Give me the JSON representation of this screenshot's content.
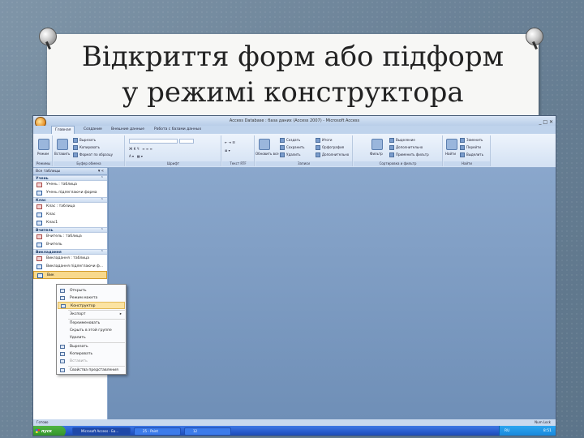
{
  "slide": {
    "title_line1": "Відкриття форм або підформ",
    "title_line2": "у режимі конструктора"
  },
  "app": {
    "window_title": "Access Database : база даних (Access 2007) - Microsoft Access",
    "window_controls": "_ □ ✕",
    "tabs": [
      "Главная",
      "Создание",
      "Внешние данные",
      "Работа с базами данных"
    ]
  },
  "ribbon": {
    "groups": [
      "Режимы",
      "Буфер обмена",
      "Шрифт",
      "Текст RTF",
      "Записи",
      "Сортировка и фильтр",
      "Найти"
    ],
    "items": {
      "view": "Режим",
      "paste": "Вставить",
      "cut": "Вырезать",
      "copy": "Копировать",
      "format_painter": "Формат по образцу",
      "refresh": "Обновить все",
      "new": "Создать",
      "save": "Сохранить",
      "delete": "Удалить",
      "totals": "Итоги",
      "spelling": "Орфография",
      "more": "Дополнительно",
      "sort_filter": "Фильтр",
      "selection": "Выделение",
      "advanced": "Дополнительно",
      "toggle_filter": "Применить фильтр",
      "find": "Найти",
      "replace": "Заменить",
      "goto": "Перейти",
      "select": "Выделить"
    }
  },
  "nav": {
    "header": "Все таблицы",
    "groups": [
      {
        "name": "Учень",
        "items": [
          {
            "label": "Учень : таблица",
            "type": "table"
          },
          {
            "label": "Учень підлеглаючи форма",
            "type": "form"
          }
        ]
      },
      {
        "name": "Клас",
        "items": [
          {
            "label": "Клас : таблица",
            "type": "table"
          },
          {
            "label": "Клас",
            "type": "form"
          },
          {
            "label": "Клас1",
            "type": "form"
          }
        ]
      },
      {
        "name": "Вчитель",
        "items": [
          {
            "label": "Вчитель : таблица",
            "type": "table"
          },
          {
            "label": "Вчитель",
            "type": "form"
          }
        ]
      },
      {
        "name": "Викладання",
        "items": [
          {
            "label": "Викладання : таблица",
            "type": "table"
          },
          {
            "label": "Викладання підлеглаючи ф...",
            "type": "form"
          },
          {
            "label": "Вик",
            "type": "form"
          }
        ]
      }
    ]
  },
  "context_menu": {
    "items": [
      {
        "label": "Открыть",
        "disabled": false
      },
      {
        "label": "Режим макета",
        "disabled": false
      },
      {
        "label": "Конструктор",
        "disabled": false
      },
      {
        "label": "Экспорт",
        "disabled": false
      },
      {
        "label": "Переименовать",
        "disabled": false
      },
      {
        "label": "Скрыть в этой группе",
        "disabled": false
      },
      {
        "label": "Удалить",
        "disabled": false
      },
      {
        "label": "Вырезать",
        "disabled": false
      },
      {
        "label": "Копировать",
        "disabled": false
      },
      {
        "label": "Вставить",
        "disabled": true
      },
      {
        "label": "Свойства представления",
        "disabled": false
      }
    ]
  },
  "status": {
    "left": "Готово",
    "right": "Num Lock"
  },
  "taskbar": {
    "start": "пуск",
    "buttons": [
      "Microsoft Access - Ба...",
      "25 - Paint",
      "12"
    ],
    "lang": "RU",
    "clock": "8:51"
  },
  "colors": {
    "accent": "#2457c8",
    "highlight": "#fbe3a2",
    "workspace": "#6f8fb7"
  }
}
